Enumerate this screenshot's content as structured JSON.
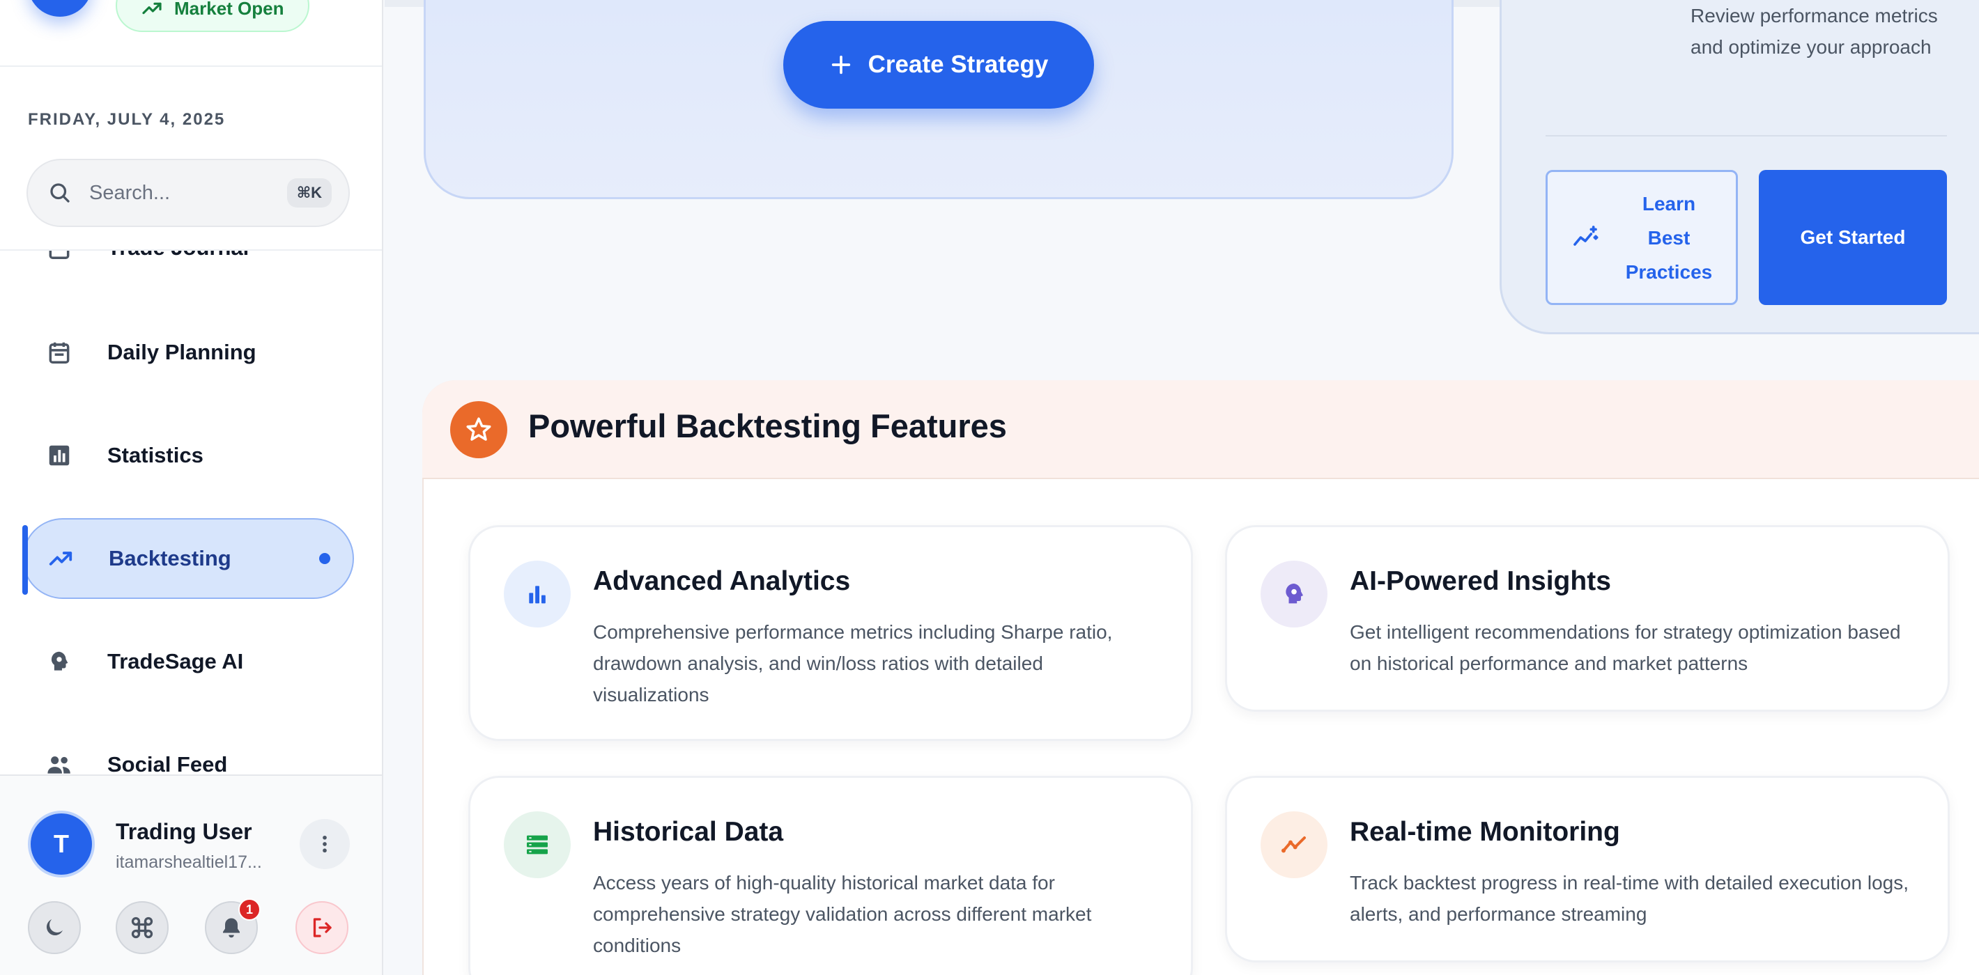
{
  "market_status": "Market Open",
  "date": "FRIDAY, JULY 4, 2025",
  "search": {
    "placeholder": "Search...",
    "shortcut": "⌘K"
  },
  "nav": [
    {
      "label": "Trade Journal",
      "icon": "journal-icon"
    },
    {
      "label": "Daily Planning",
      "icon": "calendar-icon"
    },
    {
      "label": "Statistics",
      "icon": "bar-chart-icon"
    },
    {
      "label": "Backtesting",
      "icon": "trending-up-icon",
      "active": true
    },
    {
      "label": "TradeSage AI",
      "icon": "ai-head-icon"
    },
    {
      "label": "Social Feed",
      "icon": "people-icon"
    }
  ],
  "user": {
    "initial": "T",
    "name": "Trading User",
    "email": "itamarshealtiel17..."
  },
  "notifications_count": "1",
  "create_strategy_label": "Create Strategy",
  "info_card": {
    "text": "Review performance metrics and optimize your approach",
    "learn_label": "Learn Best Practices",
    "start_label": "Get Started"
  },
  "features_title": "Powerful Backtesting Features",
  "features": [
    {
      "title": "Advanced Analytics",
      "desc": "Comprehensive performance metrics including Sharpe ratio, drawdown analysis, and win/loss ratios with detailed visualizations",
      "icon": "bar-chart-icon",
      "color": "#2563eb"
    },
    {
      "title": "AI-Powered Insights",
      "desc": "Get intelligent recommendations for strategy optimization based on historical performance and market patterns",
      "icon": "ai-head-icon",
      "color": "#6d5bd0"
    },
    {
      "title": "Historical Data",
      "desc": "Access years of high-quality historical market data for comprehensive strategy validation across different market conditions",
      "icon": "data-stack-icon",
      "color": "#16a34a"
    },
    {
      "title": "Real-time Monitoring",
      "desc": "Track backtest progress in real-time with detailed execution logs, alerts, and performance streaming",
      "icon": "trend-line-icon",
      "color": "#ea6a2a"
    }
  ],
  "colors": {
    "primary": "#2563eb",
    "accent_orange": "#ea6a2a",
    "market_green": "#15803d"
  }
}
